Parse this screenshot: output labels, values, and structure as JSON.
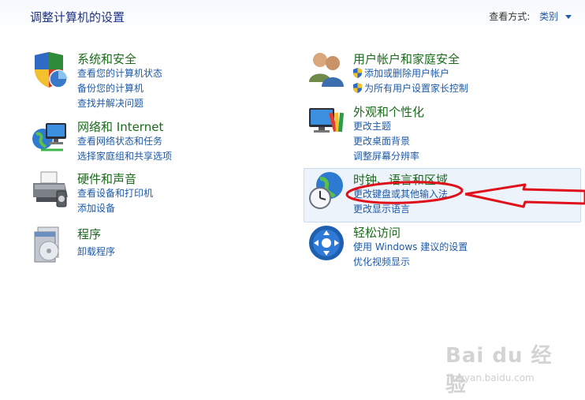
{
  "header": {
    "title": "调整计算机的设置",
    "view_by_label": "查看方式:",
    "view_by_value": "类别"
  },
  "categories": {
    "system_security": {
      "title": "系统和安全",
      "icon": "shield-pie-icon",
      "links": [
        "查看您的计算机状态",
        "备份您的计算机",
        "查找并解决问题"
      ]
    },
    "network": {
      "title": "网络和 Internet",
      "icon": "network-globe-icon",
      "links": [
        "查看网络状态和任务",
        "选择家庭组和共享选项"
      ]
    },
    "hardware_sound": {
      "title": "硬件和声音",
      "icon": "printer-icon",
      "links": [
        "查看设备和打印机",
        "添加设备"
      ]
    },
    "programs": {
      "title": "程序",
      "icon": "programs-disc-icon",
      "links": [
        "卸载程序"
      ]
    },
    "user_accounts": {
      "title": "用户帐户和家庭安全",
      "icon": "users-icon",
      "links": [
        "添加或删除用户帐户",
        "为所有用户设置家长控制"
      ]
    },
    "appearance": {
      "title": "外观和个性化",
      "icon": "monitor-palette-icon",
      "links": [
        "更改主题",
        "更改桌面背景",
        "调整屏幕分辨率"
      ]
    },
    "clock_region": {
      "title": "时钟、语言和区域",
      "icon": "clock-globe-icon",
      "links": [
        "更改键盘或其他输入法",
        "更改显示语言"
      ]
    },
    "ease_of_access": {
      "title": "轻松访问",
      "icon": "ease-of-access-icon",
      "links": [
        "使用 Windows 建议的设置",
        "优化视频显示"
      ]
    }
  },
  "annotation": {
    "color": "#e0101a"
  },
  "watermark": {
    "brand": "Bai du 经验",
    "site": "jingyan.baidu.com"
  }
}
